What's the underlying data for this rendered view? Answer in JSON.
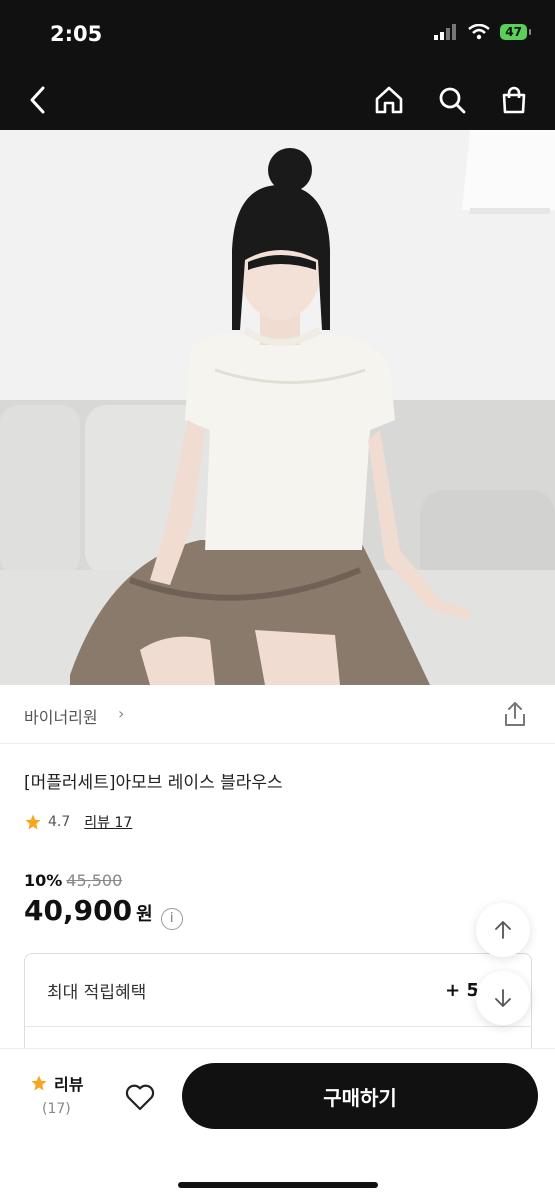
{
  "status": {
    "time": "2:05",
    "battery": "47"
  },
  "product": {
    "brand": "바이너리원",
    "title": "[머플러세트]아모브 레이스 블라우스",
    "rating": "4.7",
    "review_link": "리뷰 17",
    "discount": "10%",
    "original_price": "45,500",
    "price": "40,900",
    "currency": "원"
  },
  "benefit": {
    "label": "최대 적립혜택",
    "value": "+ 5"
  },
  "bottom_bar": {
    "review_label": "리뷰",
    "review_count": "(17)",
    "buy_label": "구매하기"
  },
  "colors": {
    "accent": "#111111",
    "star": "#f5a623",
    "battery": "#5ad05a"
  },
  "icons": [
    "back-icon",
    "home-icon",
    "search-icon",
    "cart-icon",
    "share-icon",
    "info-icon",
    "arrow-up-icon",
    "arrow-down-icon",
    "heart-icon",
    "star-icon"
  ]
}
